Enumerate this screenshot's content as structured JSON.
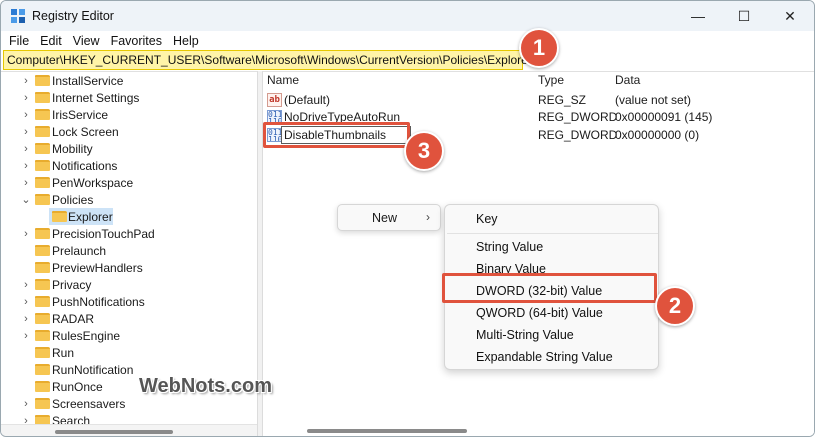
{
  "window": {
    "title": "Registry Editor",
    "controls": {
      "minimize": "—",
      "maximize": "☐",
      "close": "✕"
    }
  },
  "menu": [
    "File",
    "Edit",
    "View",
    "Favorites",
    "Help"
  ],
  "address": "Computer\\HKEY_CURRENT_USER\\Software\\Microsoft\\Windows\\CurrentVersion\\Policies\\Explorer",
  "tree": {
    "items": [
      {
        "label": "InstallService",
        "chevron": "›"
      },
      {
        "label": "Internet Settings",
        "chevron": "›"
      },
      {
        "label": "IrisService",
        "chevron": "›"
      },
      {
        "label": "Lock Screen",
        "chevron": "›"
      },
      {
        "label": "Mobility",
        "chevron": "›"
      },
      {
        "label": "Notifications",
        "chevron": "›"
      },
      {
        "label": "PenWorkspace",
        "chevron": "›"
      },
      {
        "label": "Policies",
        "chevron": "⌄"
      },
      {
        "label": "Explorer",
        "chevron": "",
        "child": true,
        "selected": true
      },
      {
        "label": "PrecisionTouchPad",
        "chevron": "›"
      },
      {
        "label": "Prelaunch",
        "chevron": ""
      },
      {
        "label": "PreviewHandlers",
        "chevron": ""
      },
      {
        "label": "Privacy",
        "chevron": "›"
      },
      {
        "label": "PushNotifications",
        "chevron": "›"
      },
      {
        "label": "RADAR",
        "chevron": "›"
      },
      {
        "label": "RulesEngine",
        "chevron": "›"
      },
      {
        "label": "Run",
        "chevron": ""
      },
      {
        "label": "RunNotification",
        "chevron": ""
      },
      {
        "label": "RunOnce",
        "chevron": ""
      },
      {
        "label": "Screensavers",
        "chevron": "›"
      },
      {
        "label": "Search",
        "chevron": "›"
      }
    ]
  },
  "list": {
    "headers": {
      "name": "Name",
      "type": "Type",
      "data": "Data"
    },
    "rows": [
      {
        "icon": "ab",
        "name": "(Default)",
        "type": "REG_SZ",
        "data": "(value not set)"
      },
      {
        "icon": "011\n110",
        "name": "NoDriveTypeAutoRun",
        "type": "REG_DWORD",
        "data": "0x00000091 (145)"
      },
      {
        "icon": "011\n110",
        "name": "DisableThumbnails",
        "type": "REG_DWORD",
        "data": "0x00000000 (0)",
        "editing": true
      }
    ]
  },
  "context_menu": {
    "new_label": "New",
    "arrow": "›",
    "submenu": [
      "Key",
      "String Value",
      "Binary Value",
      "DWORD (32-bit) Value",
      "QWORD (64-bit) Value",
      "Multi-String Value",
      "Expandable String Value"
    ]
  },
  "badges": [
    "1",
    "2",
    "3"
  ],
  "watermark": "WebNots.com",
  "colors": {
    "annotation": "#e0533d",
    "address_highlight": "#fff4a8",
    "selection": "#cde3f7",
    "folder": "#f6c652"
  }
}
